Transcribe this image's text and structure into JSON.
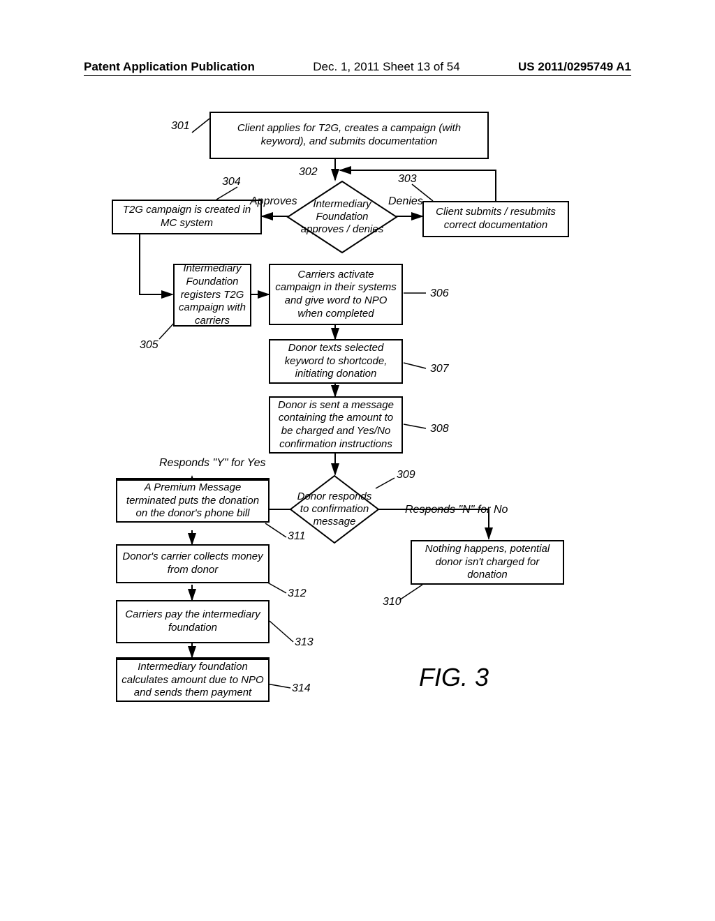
{
  "header": {
    "left": "Patent Application Publication",
    "center": "Dec. 1, 2011   Sheet 13 of 54",
    "right": "US 2011/0295749 A1"
  },
  "figure_label": "FIG. 3",
  "refs": {
    "r301": "301",
    "r302": "302",
    "r303": "303",
    "r304": "304",
    "r305": "305",
    "r306": "306",
    "r307": "307",
    "r308": "308",
    "r309": "309",
    "r310": "310",
    "r311": "311",
    "r312": "312",
    "r313": "313",
    "r314": "314"
  },
  "edges": {
    "approves": "Approves",
    "denies": "Denies",
    "resp_yes": "Responds \"Y\" for Yes",
    "resp_no": "Responds \"N\" for No"
  },
  "boxes": {
    "b301": "Client applies for T2G, creates a campaign (with keyword), and submits documentation",
    "d302": "Intermediary Foundation approves / denies",
    "b303": "Client submits / resubmits correct documentation",
    "b304": "T2G campaign is created in MC system",
    "b305": "Intermediary Foundation registers T2G campaign with carriers",
    "b306": "Carriers activate campaign in their systems and give word to NPO when completed",
    "b307": "Donor texts selected keyword to shortcode, initiating donation",
    "b308": "Donor is sent a message containing the amount to be charged and Yes/No confirmation instructions",
    "d309": "Donor responds to confirmation message",
    "b310": "Nothing happens, potential donor isn't charged for donation",
    "b311": "A Premium Message terminated puts the donation on the donor's phone bill",
    "b312": "Donor's carrier collects money from donor",
    "b313": "Carriers pay the intermediary foundation",
    "b314": "Intermediary foundation calculates amount due to NPO and sends them payment"
  }
}
